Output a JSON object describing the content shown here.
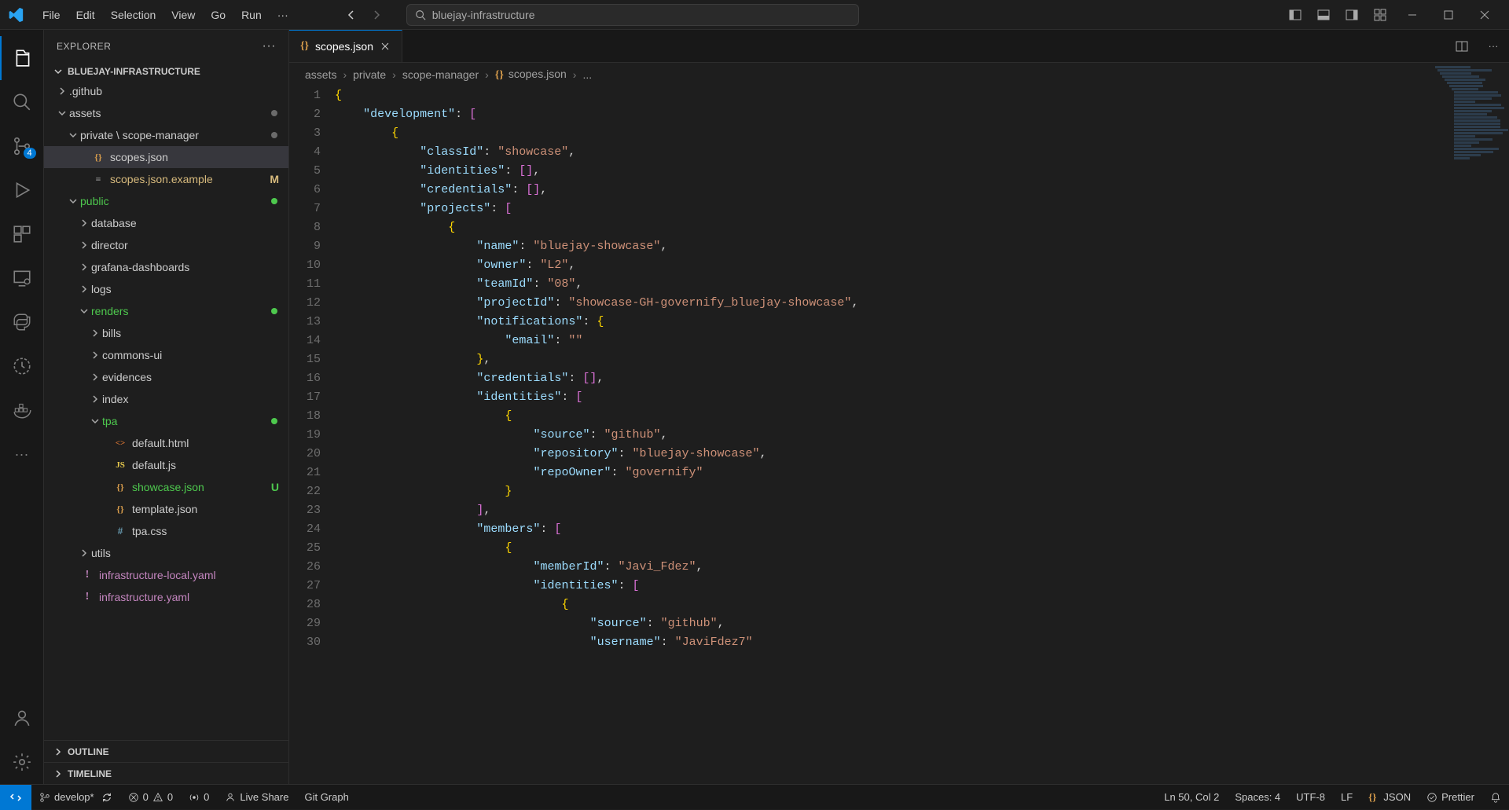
{
  "title_search": "bluejay-infrastructure",
  "menu": [
    "File",
    "Edit",
    "Selection",
    "View",
    "Go",
    "Run"
  ],
  "sidebar_title": "EXPLORER",
  "project_name": "BLUEJAY-INFRASTRUCTURE",
  "source_control_badge": "4",
  "tree": [
    {
      "indent": 0,
      "chev": "right",
      "name": ".github"
    },
    {
      "indent": 0,
      "chev": "down",
      "name": "assets",
      "dot": "gray"
    },
    {
      "indent": 1,
      "chev": "down",
      "name": "private \\ scope-manager",
      "dot": "gray"
    },
    {
      "indent": 2,
      "ficon": "json",
      "name": "scopes.json",
      "selected": true
    },
    {
      "indent": 2,
      "ficon": "file",
      "name": "scopes.json.example",
      "yellow": true,
      "status": "M"
    },
    {
      "indent": 1,
      "chev": "down",
      "name": "public",
      "green": true,
      "dot": "green"
    },
    {
      "indent": 2,
      "chev": "right",
      "name": "database"
    },
    {
      "indent": 2,
      "chev": "right",
      "name": "director"
    },
    {
      "indent": 2,
      "chev": "right",
      "name": "grafana-dashboards"
    },
    {
      "indent": 2,
      "chev": "right",
      "name": "logs"
    },
    {
      "indent": 2,
      "chev": "down",
      "name": "renders",
      "green": true,
      "dot": "green"
    },
    {
      "indent": 3,
      "chev": "right",
      "name": "bills"
    },
    {
      "indent": 3,
      "chev": "right",
      "name": "commons-ui"
    },
    {
      "indent": 3,
      "chev": "right",
      "name": "evidences"
    },
    {
      "indent": 3,
      "chev": "right",
      "name": "index"
    },
    {
      "indent": 3,
      "chev": "down",
      "name": "tpa",
      "green": true,
      "dot": "green"
    },
    {
      "indent": 4,
      "ficon": "html",
      "name": "default.html"
    },
    {
      "indent": 4,
      "ficon": "js",
      "name": "default.js"
    },
    {
      "indent": 4,
      "ficon": "json",
      "name": "showcase.json",
      "green": true,
      "status": "U"
    },
    {
      "indent": 4,
      "ficon": "json",
      "name": "template.json"
    },
    {
      "indent": 4,
      "ficon": "hash",
      "name": "tpa.css"
    },
    {
      "indent": 2,
      "chev": "right",
      "name": "utils"
    },
    {
      "indent": 1,
      "ficon": "excl",
      "name": "infrastructure-local.yaml",
      "magenta": true
    },
    {
      "indent": 1,
      "ficon": "excl",
      "name": "infrastructure.yaml",
      "magenta": true
    }
  ],
  "outline_label": "OUTLINE",
  "timeline_label": "TIMELINE",
  "tab_name": "scopes.json",
  "breadcrumb": [
    "assets",
    "private",
    "scope-manager",
    "scopes.json",
    "..."
  ],
  "code_lines": [
    "{",
    "    \"development\": [",
    "        {",
    "            \"classId\": \"showcase\",",
    "            \"identities\": [],",
    "            \"credentials\": [],",
    "            \"projects\": [",
    "                {",
    "                    \"name\": \"bluejay-showcase\",",
    "                    \"owner\": \"L2\",",
    "                    \"teamId\": \"08\",",
    "                    \"projectId\": \"showcase-GH-governify_bluejay-showcase\",",
    "                    \"notifications\": {",
    "                        \"email\": \"\"",
    "                    },",
    "                    \"credentials\": [],",
    "                    \"identities\": [",
    "                        {",
    "                            \"source\": \"github\",",
    "                            \"repository\": \"bluejay-showcase\",",
    "                            \"repoOwner\": \"governify\"",
    "                        }",
    "                    ],",
    "                    \"members\": [",
    "                        {",
    "                            \"memberId\": \"Javi_Fdez\",",
    "                            \"identities\": [",
    "                                {",
    "                                    \"source\": \"github\",",
    "                                    \"username\": \"JaviFdez7\""
  ],
  "status_left": {
    "branch": "develop*",
    "errors": "0",
    "warnings": "0",
    "ports": "0",
    "liveshare": "Live Share",
    "gitgraph": "Git Graph"
  },
  "status_right": {
    "cursor": "Ln 50, Col 2",
    "spaces": "Spaces: 4",
    "encoding": "UTF-8",
    "eol": "LF",
    "lang": "JSON",
    "formatter": "Prettier"
  }
}
